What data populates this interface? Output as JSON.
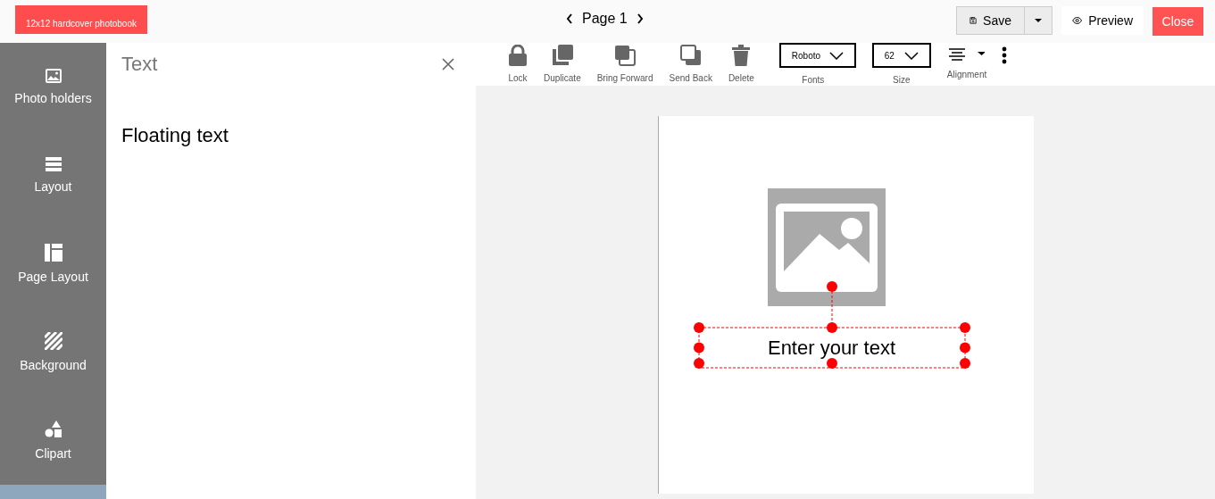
{
  "header": {
    "product_badge": "12x12 hardcover photobook",
    "page_label": "Page 1",
    "save_label": "Save",
    "preview_label": "Preview",
    "close_label": "Close"
  },
  "sidebar": {
    "items": [
      {
        "label": "Photo holders",
        "kind": "image",
        "selected": false
      },
      {
        "label": "Layout",
        "kind": "rows",
        "selected": false
      },
      {
        "label": "Page Layout",
        "kind": "page",
        "selected": false
      },
      {
        "label": "Background",
        "kind": "stripes",
        "selected": false
      },
      {
        "label": "Clipart",
        "kind": "shapes",
        "selected": false
      },
      {
        "selected": true
      }
    ]
  },
  "panel": {
    "title": "Text",
    "items": [
      "Floating text"
    ]
  },
  "toolbar": {
    "tools": [
      {
        "label": "Lock",
        "kind": "lock"
      },
      {
        "label": "Duplicate",
        "kind": "duplicate"
      },
      {
        "label": "Bring Forward",
        "kind": "forward"
      },
      {
        "label": "Send Back",
        "kind": "back"
      },
      {
        "label": "Delete",
        "kind": "trash"
      }
    ],
    "fonts": {
      "value": "Roboto",
      "label": "Fonts"
    },
    "size": {
      "value": "62",
      "label": "Size"
    },
    "alignment": {
      "label": "Alignment"
    }
  },
  "canvas": {
    "text": "Enter your text",
    "text_selected": true
  }
}
